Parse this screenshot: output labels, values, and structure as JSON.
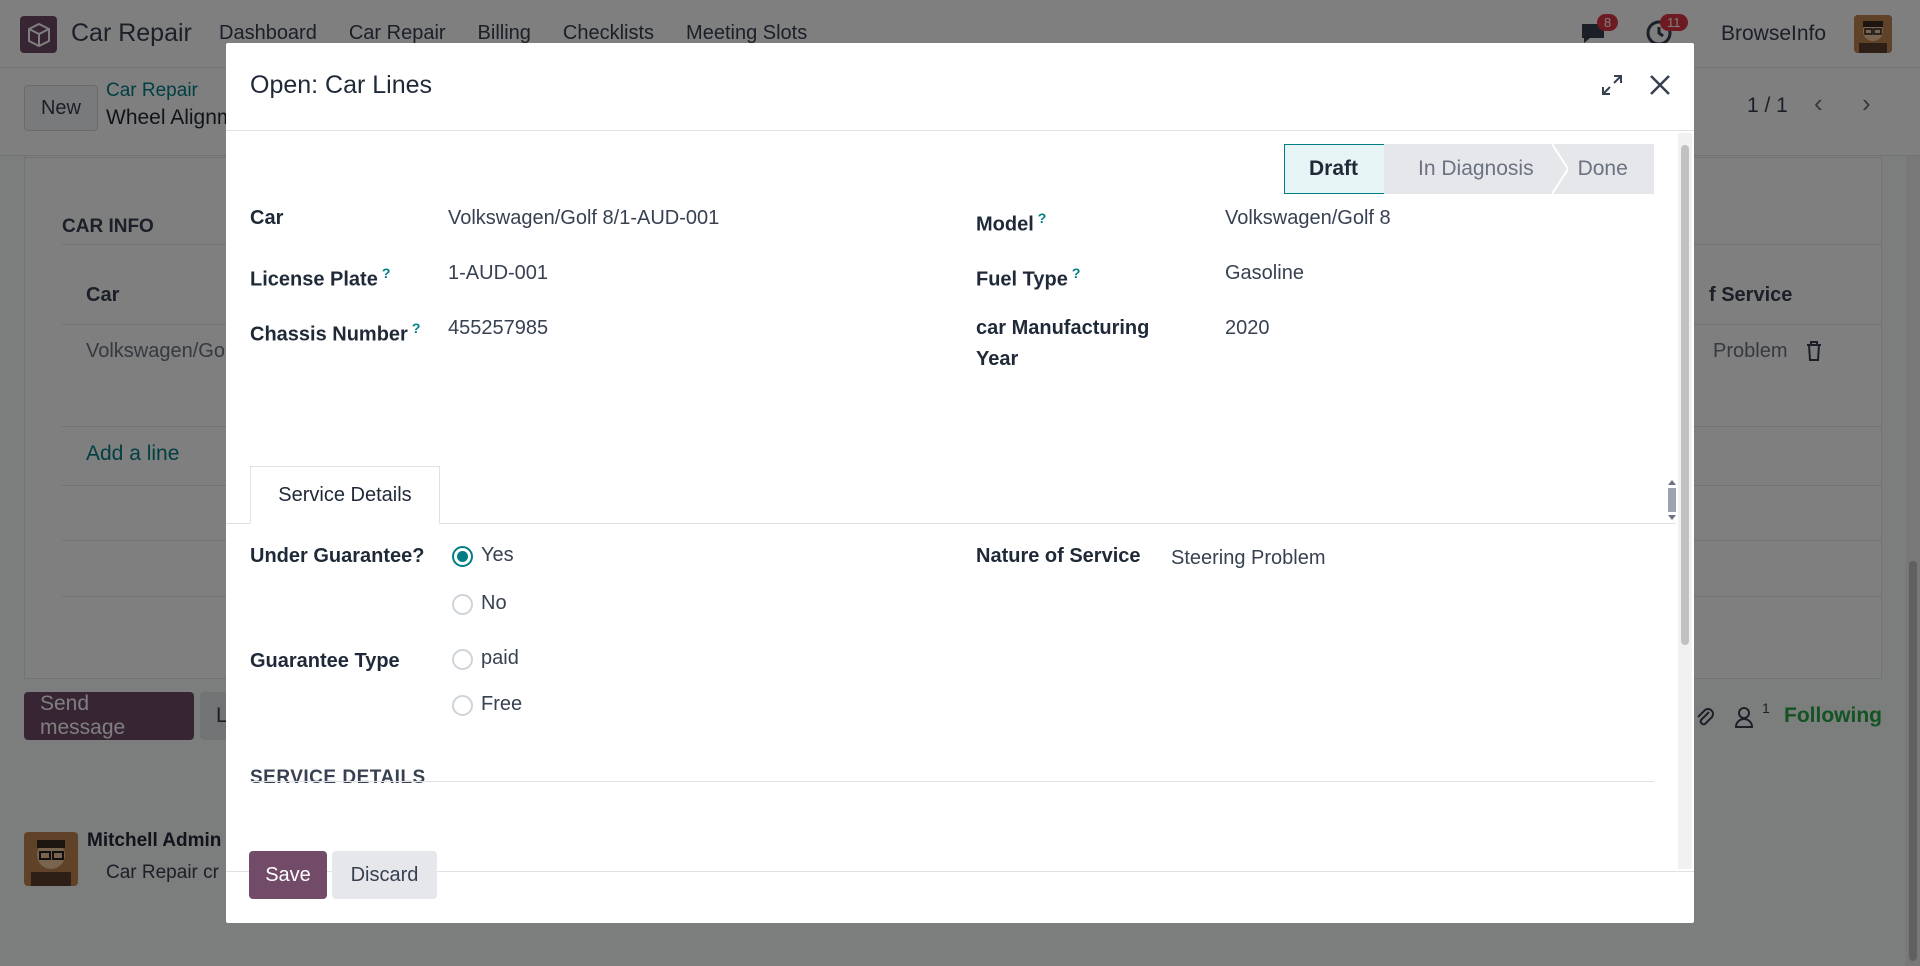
{
  "navbar": {
    "app_name": "Car Repair",
    "menu": [
      "Dashboard",
      "Car Repair",
      "Billing",
      "Checklists",
      "Meeting Slots"
    ],
    "messages_badge": "8",
    "activities_badge": "11",
    "user_name": "BrowseInfo"
  },
  "control_panel": {
    "new_label": "New",
    "breadcrumb_parent": "Car Repair",
    "breadcrumb_current": "Wheel Alignm",
    "pager": "1 / 1"
  },
  "background": {
    "car_info_title": "CAR INFO",
    "col_car": "Car",
    "col_service": "f Service",
    "row_car": "Volkswagen/Go",
    "row_service": "Problem",
    "add_line": "Add a line",
    "send_message": "Send message",
    "log_note": "L",
    "followers_count": "1",
    "following": "Following",
    "author": "Mitchell Admin",
    "message": "Car Repair cr"
  },
  "modal": {
    "title": "Open: Car Lines",
    "stages": [
      "Draft",
      "In Diagnosis",
      "Done"
    ],
    "active_stage": "Draft",
    "fields": {
      "car_label": "Car",
      "car_value": "Volkswagen/Golf 8/1-AUD-001",
      "model_label": "Model",
      "model_value": "Volkswagen/Golf 8",
      "license_label": "License Plate",
      "license_value": "1-AUD-001",
      "fuel_label": "Fuel Type",
      "fuel_value": "Gasoline",
      "chassis_label": "Chassis Number",
      "chassis_value": "455257985",
      "year_label_1": "car Manufacturing",
      "year_label_2": "Year",
      "year_value": "2020",
      "help_mark": "?"
    },
    "tab": "Service Details",
    "service": {
      "guarantee_label": "Under Guarantee?",
      "guarantee_options": [
        "Yes",
        "No"
      ],
      "guarantee_selected": "Yes",
      "guarantee_type_label": "Guarantee Type",
      "guarantee_type_options": [
        "paid",
        "Free"
      ],
      "nature_label": "Nature of Service",
      "nature_value": "Steering Problem"
    },
    "section_title": "SERVICE DETAILS",
    "save_label": "Save",
    "discard_label": "Discard"
  },
  "colors": {
    "brand": "#714b67",
    "accent": "#017e84",
    "badge": "#dc3545",
    "following": "#28a745"
  }
}
